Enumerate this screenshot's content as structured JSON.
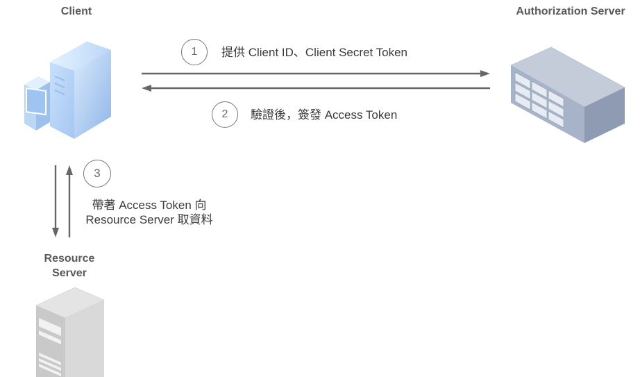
{
  "nodes": {
    "client": {
      "title": "Client"
    },
    "auth_server": {
      "title": "Authorization Server"
    },
    "resource_server": {
      "title_line1": "Resource",
      "title_line2": "Server"
    }
  },
  "steps": [
    {
      "number": "1",
      "label": "提供 Client ID、Client Secret Token"
    },
    {
      "number": "2",
      "label": "驗證後，簽發 Access Token"
    },
    {
      "number": "3",
      "label_line1": "帶著 Access Token 向",
      "label_line2": "Resource Server 取資料"
    }
  ],
  "colors": {
    "arrow": "#666666",
    "client_blue": "#a9c8f0",
    "auth_server_body": "#a7b3c8",
    "resource_server_body": "#cfcfcf",
    "title_text": "#595959"
  }
}
